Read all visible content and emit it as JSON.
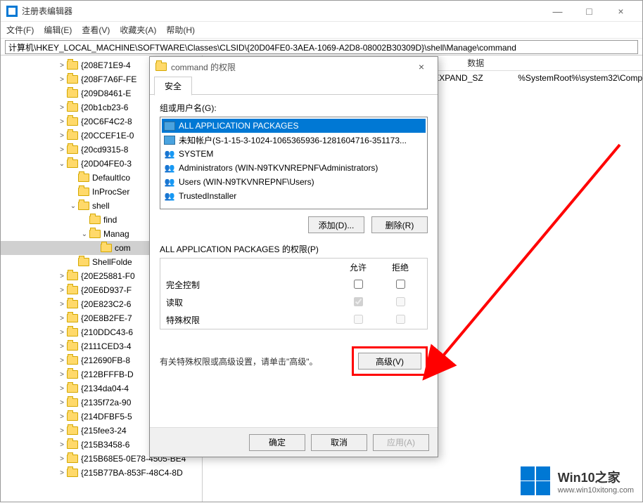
{
  "window": {
    "title": "注册表编辑器",
    "min": "—",
    "max": "□",
    "close": "×"
  },
  "menu": {
    "file": "文件(F)",
    "edit": "编辑(E)",
    "view": "查看(V)",
    "favorites": "收藏夹(A)",
    "help": "帮助(H)"
  },
  "address": "计算机\\HKEY_LOCAL_MACHINE\\SOFTWARE\\Classes\\CLSID\\{20D04FE0-3AEA-1069-A2D8-08002B30309D}\\shell\\Manage\\command",
  "tree": [
    {
      "depth": 5,
      "expand": ">",
      "label": "{208E71E9-4"
    },
    {
      "depth": 5,
      "expand": ">",
      "label": "{208F7A6F-FE"
    },
    {
      "depth": 5,
      "expand": "",
      "label": "{209D8461-E"
    },
    {
      "depth": 5,
      "expand": ">",
      "label": "{20b1cb23-6"
    },
    {
      "depth": 5,
      "expand": ">",
      "label": "{20C6F4C2-8"
    },
    {
      "depth": 5,
      "expand": ">",
      "label": "{20CCEF1E-0"
    },
    {
      "depth": 5,
      "expand": ">",
      "label": "{20cd9315-8"
    },
    {
      "depth": 5,
      "expand": "v",
      "label": "{20D04FE0-3"
    },
    {
      "depth": 6,
      "expand": "",
      "label": "DefaultIco"
    },
    {
      "depth": 6,
      "expand": "",
      "label": "InProcSer"
    },
    {
      "depth": 6,
      "expand": "v",
      "label": "shell"
    },
    {
      "depth": 7,
      "expand": "",
      "label": "find"
    },
    {
      "depth": 7,
      "expand": "v",
      "label": "Manag"
    },
    {
      "depth": 8,
      "expand": "",
      "label": "com",
      "sel": true
    },
    {
      "depth": 6,
      "expand": "",
      "label": "ShellFolde"
    },
    {
      "depth": 5,
      "expand": ">",
      "label": "{20E25881-F0"
    },
    {
      "depth": 5,
      "expand": ">",
      "label": "{20E6D937-F"
    },
    {
      "depth": 5,
      "expand": ">",
      "label": "{20E823C2-6"
    },
    {
      "depth": 5,
      "expand": ">",
      "label": "{20E8B2FE-7"
    },
    {
      "depth": 5,
      "expand": ">",
      "label": "{210DDC43-6"
    },
    {
      "depth": 5,
      "expand": ">",
      "label": "{2111CED3-4"
    },
    {
      "depth": 5,
      "expand": ">",
      "label": "{212690FB-8"
    },
    {
      "depth": 5,
      "expand": ">",
      "label": "{212BFFFB-D"
    },
    {
      "depth": 5,
      "expand": ">",
      "label": "{2134da04-4"
    },
    {
      "depth": 5,
      "expand": ">",
      "label": "{2135f72a-90"
    },
    {
      "depth": 5,
      "expand": ">",
      "label": "{214DFBF5-5"
    },
    {
      "depth": 5,
      "expand": ">",
      "label": "{215fee3-24"
    },
    {
      "depth": 5,
      "expand": ">",
      "label": "{215B3458-6"
    },
    {
      "depth": 5,
      "expand": ">",
      "label": "{215B68E5-0E78-4505-BE4"
    },
    {
      "depth": 5,
      "expand": ">",
      "label": "{215B77BA-853F-48C4-8D"
    }
  ],
  "list": {
    "col_type": "",
    "col_data": "数据",
    "row_type": "EXPAND_SZ",
    "row_data": "%SystemRoot%\\system32\\Comp"
  },
  "dialog": {
    "title": "command 的权限",
    "close": "×",
    "tab_security": "安全",
    "groups_label": "组或用户名(G):",
    "groups": [
      {
        "icon": "pkg",
        "label": "ALL APPLICATION PACKAGES",
        "sel": true
      },
      {
        "icon": "pkg",
        "label": "未知帐户(S-1-15-3-1024-1065365936-1281604716-351173..."
      },
      {
        "icon": "users",
        "label": "SYSTEM"
      },
      {
        "icon": "users",
        "label": "Administrators (WIN-N9TKVNREPNF\\Administrators)"
      },
      {
        "icon": "users",
        "label": "Users (WIN-N9TKVNREPNF\\Users)"
      },
      {
        "icon": "users",
        "label": "TrustedInstaller"
      }
    ],
    "btn_add": "添加(D)...",
    "btn_remove": "删除(R)",
    "perms_for": "ALL APPLICATION PACKAGES 的权限(P)",
    "allow": "允许",
    "deny": "拒绝",
    "perms": [
      {
        "name": "完全控制",
        "allow": false,
        "deny": false,
        "disabled": false
      },
      {
        "name": "读取",
        "allow": true,
        "deny": false,
        "disabled": true
      },
      {
        "name": "特殊权限",
        "allow": false,
        "deny": false,
        "disabled": true
      }
    ],
    "adv_note": "有关特殊权限或高级设置，请单击\"高级\"。",
    "btn_advanced": "高级(V)",
    "btn_ok": "确定",
    "btn_cancel": "取消",
    "btn_apply": "应用(A)"
  },
  "watermark": {
    "brand": "Win10之家",
    "url": "www.win10xitong.com"
  }
}
